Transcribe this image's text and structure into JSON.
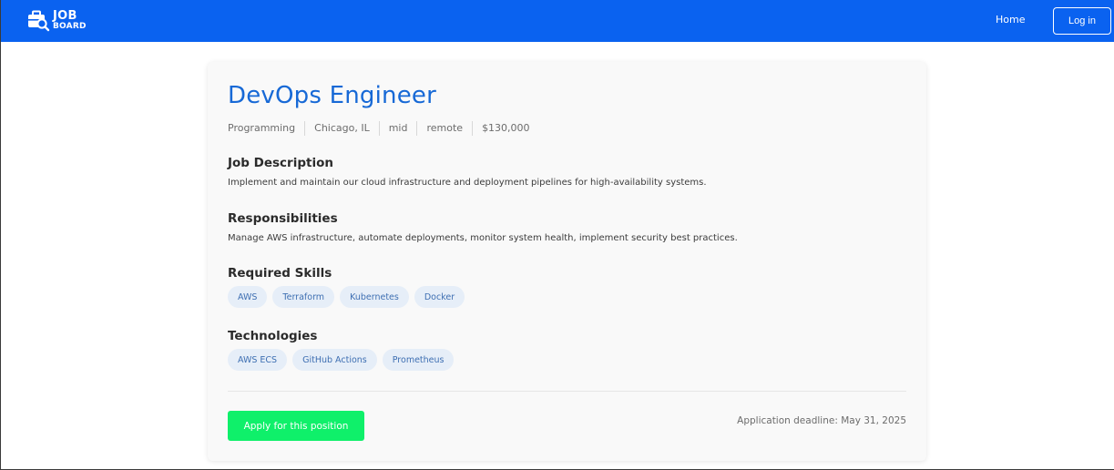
{
  "nav": {
    "brand_line1": "JOB",
    "brand_line2": "BOARD",
    "home_label": "Home",
    "login_label": "Log in",
    "bar_color": "#0a62f0"
  },
  "job": {
    "title": "DevOps Engineer",
    "meta": [
      "Programming",
      "Chicago, IL",
      "mid",
      "remote",
      "$130,000"
    ],
    "description_heading": "Job Description",
    "description": "Implement and maintain our cloud infrastructure and deployment pipelines for high-availability systems.",
    "responsibilities_heading": "Responsibilities",
    "responsibilities": "Manage AWS infrastructure, automate deployments, monitor system health, implement security best practices.",
    "skills_heading": "Required Skills",
    "skills": [
      "AWS",
      "Terraform",
      "Kubernetes",
      "Docker"
    ],
    "technologies_heading": "Technologies",
    "technologies": [
      "AWS ECS",
      "GitHub Actions",
      "Prometheus"
    ],
    "apply_label": "Apply for this position",
    "deadline": "Application deadline: May 31, 2025"
  },
  "colors": {
    "title": "#1769d6",
    "apply_button": "#0ff06a",
    "tag_background": "#e6eef8",
    "tag_text": "#3e6fb2"
  },
  "icons": {
    "brand": "briefcase-search-icon"
  }
}
